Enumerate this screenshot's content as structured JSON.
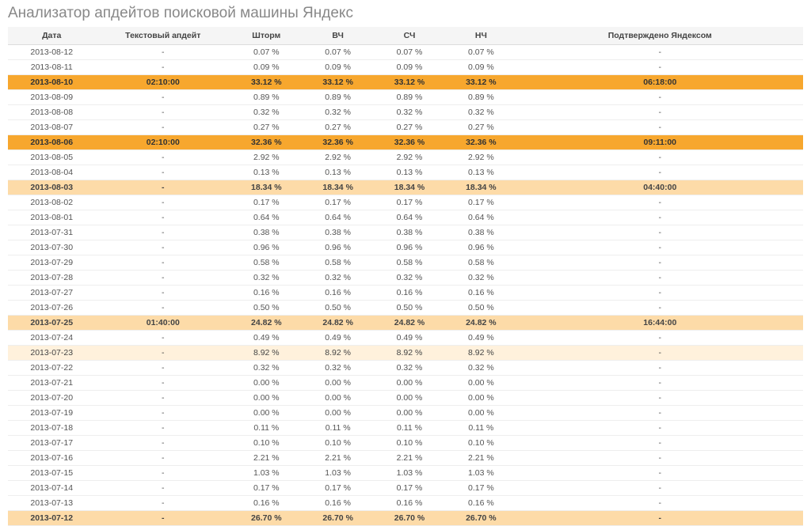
{
  "title": "Анализатор апдейтов поисковой машины Яндекс",
  "headers": [
    "Дата",
    "Текстовый апдейт",
    "Шторм",
    "ВЧ",
    "СЧ",
    "НЧ",
    "Подтверждено Яндексом"
  ],
  "rows": [
    {
      "date": "2013-08-12",
      "text": "-",
      "storm": "0.07 %",
      "vch": "0.07 %",
      "sch": "0.07 %",
      "nch": "0.07 %",
      "conf": "-",
      "hl": ""
    },
    {
      "date": "2013-08-11",
      "text": "-",
      "storm": "0.09 %",
      "vch": "0.09 %",
      "sch": "0.09 %",
      "nch": "0.09 %",
      "conf": "-",
      "hl": ""
    },
    {
      "date": "2013-08-10",
      "text": "02:10:00",
      "storm": "33.12 %",
      "vch": "33.12 %",
      "sch": "33.12 %",
      "nch": "33.12 %",
      "conf": "06:18:00",
      "hl": "h-high"
    },
    {
      "date": "2013-08-09",
      "text": "-",
      "storm": "0.89 %",
      "vch": "0.89 %",
      "sch": "0.89 %",
      "nch": "0.89 %",
      "conf": "-",
      "hl": ""
    },
    {
      "date": "2013-08-08",
      "text": "-",
      "storm": "0.32 %",
      "vch": "0.32 %",
      "sch": "0.32 %",
      "nch": "0.32 %",
      "conf": "-",
      "hl": ""
    },
    {
      "date": "2013-08-07",
      "text": "-",
      "storm": "0.27 %",
      "vch": "0.27 %",
      "sch": "0.27 %",
      "nch": "0.27 %",
      "conf": "-",
      "hl": ""
    },
    {
      "date": "2013-08-06",
      "text": "02:10:00",
      "storm": "32.36 %",
      "vch": "32.36 %",
      "sch": "32.36 %",
      "nch": "32.36 %",
      "conf": "09:11:00",
      "hl": "h-high"
    },
    {
      "date": "2013-08-05",
      "text": "-",
      "storm": "2.92 %",
      "vch": "2.92 %",
      "sch": "2.92 %",
      "nch": "2.92 %",
      "conf": "-",
      "hl": ""
    },
    {
      "date": "2013-08-04",
      "text": "-",
      "storm": "0.13 %",
      "vch": "0.13 %",
      "sch": "0.13 %",
      "nch": "0.13 %",
      "conf": "-",
      "hl": ""
    },
    {
      "date": "2013-08-03",
      "text": "-",
      "storm": "18.34 %",
      "vch": "18.34 %",
      "sch": "18.34 %",
      "nch": "18.34 %",
      "conf": "04:40:00",
      "hl": "h-med"
    },
    {
      "date": "2013-08-02",
      "text": "-",
      "storm": "0.17 %",
      "vch": "0.17 %",
      "sch": "0.17 %",
      "nch": "0.17 %",
      "conf": "-",
      "hl": ""
    },
    {
      "date": "2013-08-01",
      "text": "-",
      "storm": "0.64 %",
      "vch": "0.64 %",
      "sch": "0.64 %",
      "nch": "0.64 %",
      "conf": "-",
      "hl": ""
    },
    {
      "date": "2013-07-31",
      "text": "-",
      "storm": "0.38 %",
      "vch": "0.38 %",
      "sch": "0.38 %",
      "nch": "0.38 %",
      "conf": "-",
      "hl": ""
    },
    {
      "date": "2013-07-30",
      "text": "-",
      "storm": "0.96 %",
      "vch": "0.96 %",
      "sch": "0.96 %",
      "nch": "0.96 %",
      "conf": "-",
      "hl": ""
    },
    {
      "date": "2013-07-29",
      "text": "-",
      "storm": "0.58 %",
      "vch": "0.58 %",
      "sch": "0.58 %",
      "nch": "0.58 %",
      "conf": "-",
      "hl": ""
    },
    {
      "date": "2013-07-28",
      "text": "-",
      "storm": "0.32 %",
      "vch": "0.32 %",
      "sch": "0.32 %",
      "nch": "0.32 %",
      "conf": "-",
      "hl": ""
    },
    {
      "date": "2013-07-27",
      "text": "-",
      "storm": "0.16 %",
      "vch": "0.16 %",
      "sch": "0.16 %",
      "nch": "0.16 %",
      "conf": "-",
      "hl": ""
    },
    {
      "date": "2013-07-26",
      "text": "-",
      "storm": "0.50 %",
      "vch": "0.50 %",
      "sch": "0.50 %",
      "nch": "0.50 %",
      "conf": "-",
      "hl": ""
    },
    {
      "date": "2013-07-25",
      "text": "01:40:00",
      "storm": "24.82 %",
      "vch": "24.82 %",
      "sch": "24.82 %",
      "nch": "24.82 %",
      "conf": "16:44:00",
      "hl": "h-med"
    },
    {
      "date": "2013-07-24",
      "text": "-",
      "storm": "0.49 %",
      "vch": "0.49 %",
      "sch": "0.49 %",
      "nch": "0.49 %",
      "conf": "-",
      "hl": ""
    },
    {
      "date": "2013-07-23",
      "text": "-",
      "storm": "8.92 %",
      "vch": "8.92 %",
      "sch": "8.92 %",
      "nch": "8.92 %",
      "conf": "-",
      "hl": "h-low"
    },
    {
      "date": "2013-07-22",
      "text": "-",
      "storm": "0.32 %",
      "vch": "0.32 %",
      "sch": "0.32 %",
      "nch": "0.32 %",
      "conf": "-",
      "hl": ""
    },
    {
      "date": "2013-07-21",
      "text": "-",
      "storm": "0.00 %",
      "vch": "0.00 %",
      "sch": "0.00 %",
      "nch": "0.00 %",
      "conf": "-",
      "hl": ""
    },
    {
      "date": "2013-07-20",
      "text": "-",
      "storm": "0.00 %",
      "vch": "0.00 %",
      "sch": "0.00 %",
      "nch": "0.00 %",
      "conf": "-",
      "hl": ""
    },
    {
      "date": "2013-07-19",
      "text": "-",
      "storm": "0.00 %",
      "vch": "0.00 %",
      "sch": "0.00 %",
      "nch": "0.00 %",
      "conf": "-",
      "hl": ""
    },
    {
      "date": "2013-07-18",
      "text": "-",
      "storm": "0.11 %",
      "vch": "0.11 %",
      "sch": "0.11 %",
      "nch": "0.11 %",
      "conf": "-",
      "hl": ""
    },
    {
      "date": "2013-07-17",
      "text": "-",
      "storm": "0.10 %",
      "vch": "0.10 %",
      "sch": "0.10 %",
      "nch": "0.10 %",
      "conf": "-",
      "hl": ""
    },
    {
      "date": "2013-07-16",
      "text": "-",
      "storm": "2.21 %",
      "vch": "2.21 %",
      "sch": "2.21 %",
      "nch": "2.21 %",
      "conf": "-",
      "hl": ""
    },
    {
      "date": "2013-07-15",
      "text": "-",
      "storm": "1.03 %",
      "vch": "1.03 %",
      "sch": "1.03 %",
      "nch": "1.03 %",
      "conf": "-",
      "hl": ""
    },
    {
      "date": "2013-07-14",
      "text": "-",
      "storm": "0.17 %",
      "vch": "0.17 %",
      "sch": "0.17 %",
      "nch": "0.17 %",
      "conf": "-",
      "hl": ""
    },
    {
      "date": "2013-07-13",
      "text": "-",
      "storm": "0.16 %",
      "vch": "0.16 %",
      "sch": "0.16 %",
      "nch": "0.16 %",
      "conf": "-",
      "hl": ""
    },
    {
      "date": "2013-07-12",
      "text": "-",
      "storm": "26.70 %",
      "vch": "26.70 %",
      "sch": "26.70 %",
      "nch": "26.70 %",
      "conf": "-",
      "hl": "h-med"
    }
  ]
}
